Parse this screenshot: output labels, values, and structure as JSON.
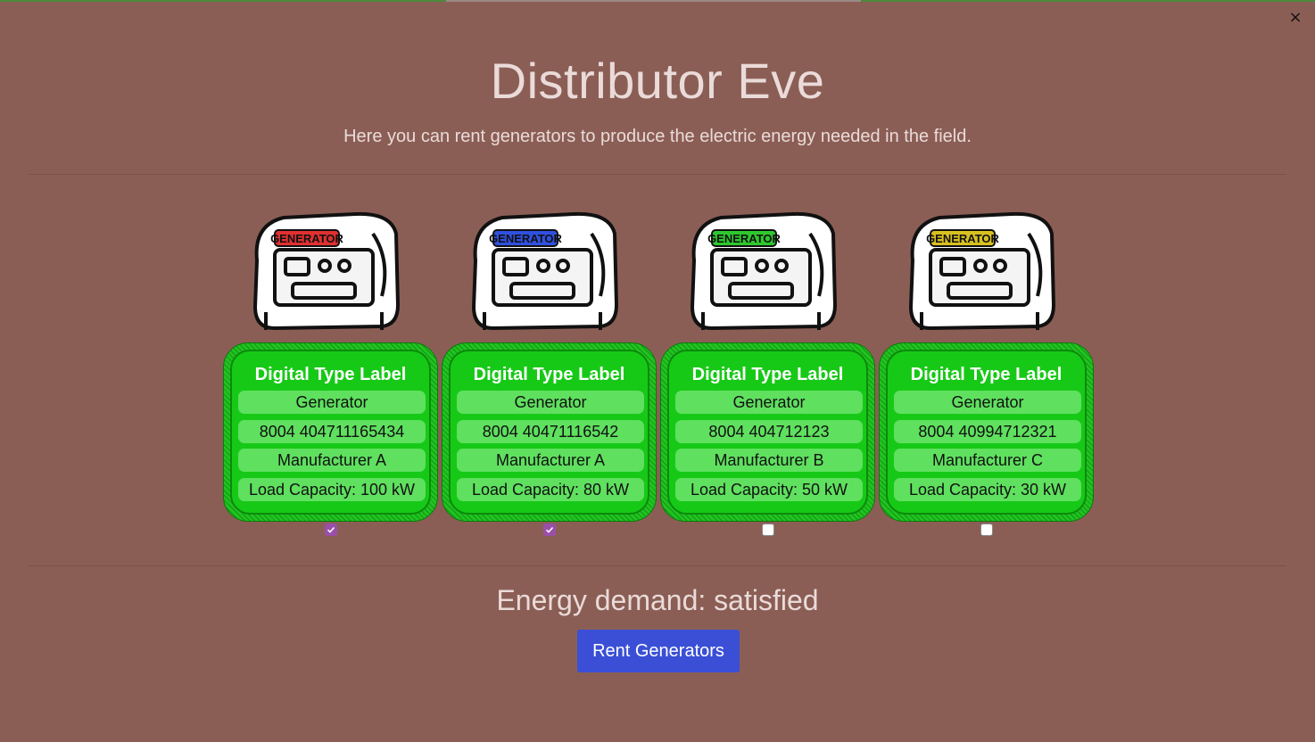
{
  "close_label": "×",
  "title": "Distributor Eve",
  "subtitle": "Here you can rent generators to produce the electric energy needed in the field.",
  "generators": [
    {
      "image_text": "GENERATOR",
      "image_accent": "#e03030",
      "label_title": "Digital Type Label",
      "type": "Generator",
      "id": "8004 404711165434",
      "manufacturer": "Manufacturer A",
      "capacity": "Load Capacity: 100 kW",
      "selected": true
    },
    {
      "image_text": "GENERATOR",
      "image_accent": "#3050e0",
      "label_title": "Digital Type Label",
      "type": "Generator",
      "id": "8004 40471116542",
      "manufacturer": "Manufacturer A",
      "capacity": "Load Capacity: 80 kW",
      "selected": true
    },
    {
      "image_text": "GENERATOR",
      "image_accent": "#2ec82e",
      "label_title": "Digital Type Label",
      "type": "Generator",
      "id": "8004 404712123",
      "manufacturer": "Manufacturer B",
      "capacity": "Load Capacity: 50 kW",
      "selected": false
    },
    {
      "image_text": "GENERATOR",
      "image_accent": "#d8c020",
      "label_title": "Digital Type Label",
      "type": "Generator",
      "id": "8004 40994712321",
      "manufacturer": "Manufacturer C",
      "capacity": "Load Capacity: 30 kW",
      "selected": false
    }
  ],
  "energy_demand": "Energy demand: satisfied",
  "rent_button": "Rent Generators",
  "colors": {
    "background": "#8b5e55",
    "label_green": "#17c917",
    "checkbox_checked": "#9a4fa9",
    "button": "#3a4fd6"
  }
}
